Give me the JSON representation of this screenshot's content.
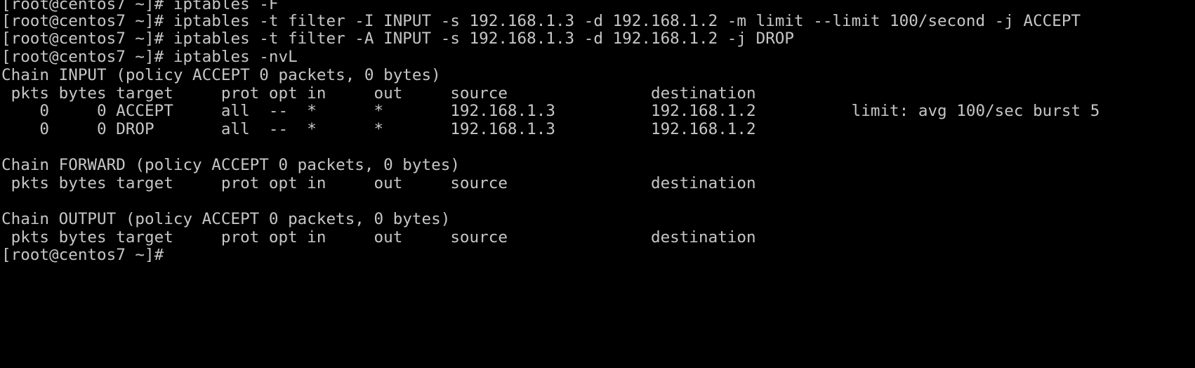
{
  "terminal": {
    "lines": [
      "[root@centos7 ~]# iptables -F",
      "[root@centos7 ~]# iptables -t filter -I INPUT -s 192.168.1.3 -d 192.168.1.2 -m limit --limit 100/second -j ACCEPT",
      "[root@centos7 ~]# iptables -t filter -A INPUT -s 192.168.1.3 -d 192.168.1.2 -j DROP",
      "[root@centos7 ~]# iptables -nvL",
      "Chain INPUT (policy ACCEPT 0 packets, 0 bytes)",
      " pkts bytes target     prot opt in     out     source               destination",
      "    0     0 ACCEPT     all  --  *      *       192.168.1.3          192.168.1.2          limit: avg 100/sec burst 5",
      "    0     0 DROP       all  --  *      *       192.168.1.3          192.168.1.2",
      "",
      "Chain FORWARD (policy ACCEPT 0 packets, 0 bytes)",
      " pkts bytes target     prot opt in     out     source               destination",
      "",
      "Chain OUTPUT (policy ACCEPT 0 packets, 0 bytes)",
      " pkts bytes target     prot opt in     out     source               destination",
      "[root@centos7 ~]#"
    ],
    "colors": {
      "background": "#000000",
      "text": "#c6c6c6"
    }
  }
}
